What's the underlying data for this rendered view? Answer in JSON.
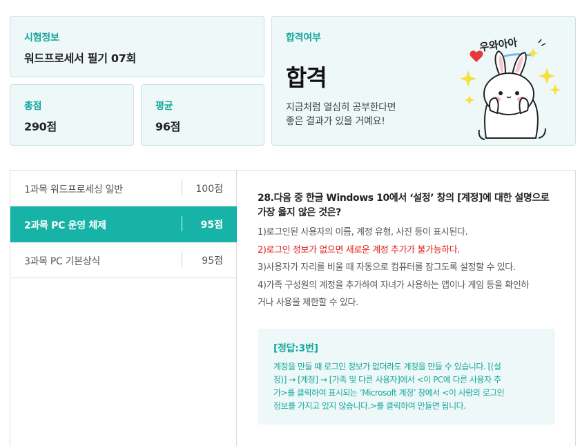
{
  "exam_info": {
    "label": "시험정보",
    "value": "워드프로세서 필기 07회"
  },
  "total": {
    "label": "총점",
    "value": "290점"
  },
  "average": {
    "label": "평균",
    "value": "96점"
  },
  "result": {
    "label": "합격여부",
    "value": "합격",
    "message_line1": "지금처럼 열심히 공부한다면",
    "message_line2": "좋은 결과가 있을 거예요!",
    "mascot_text": "우와아아"
  },
  "subjects": [
    {
      "name": "1과목 워드프로세싱 일반",
      "score": "100점",
      "active": false
    },
    {
      "name": "2과목 PC 운영 체제",
      "score": "95점",
      "active": true
    },
    {
      "name": "3과목 PC 기본상식",
      "score": "95점",
      "active": false
    }
  ],
  "question": {
    "title_line1": "28.다음 중 한글 Windows 10에서 ‘설정’ 창의 [계정]에 대한 설명으로",
    "title_line2": "가장 옳지 않은 것은?",
    "options": [
      "1)로그인된 사용자의 이름, 계정 유형, 사진 등이 표시된다.",
      "2)로그인 정보가 없으면 새로운 계정 추가가 불가능하다.",
      "3)사용자가 자리를 비울 때 자동으로 컴퓨터를 잠그도록 설정할 수 있다.",
      "4)가족 구성원의 계정을 추가하여 자녀가 사용하는 앱이나 게임 등을 확인하",
      "거나 사용을 제한할 수 있다."
    ]
  },
  "answer": {
    "title": "[정답:3번]",
    "line1": "계정을 만들 때 로그인 정보가 없더라도 계정을 만들 수 있습니다. [(설",
    "line2": "정)] → [계정] → [가족 및 다른 사용자]에서 <이 PC에 다른 사용자 추",
    "line3": "가>를 클릭하여 표시되는 ‘Microsoft 계정’ 창에서 <이 사람의 로그인",
    "line4": "정보를 가지고 있지 않습니다.>를 클릭하여 만들면 됩니다."
  },
  "colors": {
    "accent": "#16b3a6",
    "card_bg": "#eef8f8",
    "wrong": "#e51c1c"
  }
}
